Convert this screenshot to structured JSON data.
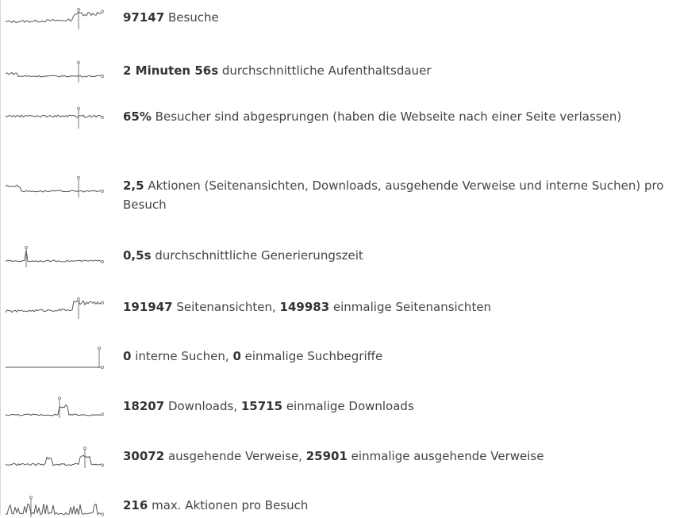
{
  "stats": [
    {
      "parts": [
        {
          "b": "97147"
        },
        {
          "t": " Besuche"
        }
      ]
    },
    {
      "parts": [
        {
          "b": "2 Minuten 56s"
        },
        {
          "t": " durchschnittliche Aufenthaltsdauer"
        }
      ]
    },
    {
      "parts": [
        {
          "b": "65%"
        },
        {
          "t": " Besucher sind abgesprungen (haben die Webseite nach einer Seite verlassen)"
        }
      ]
    },
    {
      "parts": [
        {
          "b": "2,5"
        },
        {
          "t": " Aktionen (Seitenansichten, Downloads, ausgehende Verweise und interne Suchen) pro Besuch"
        }
      ]
    },
    {
      "parts": [
        {
          "b": "0,5s"
        },
        {
          "t": " durchschnittliche Generierungszeit"
        }
      ]
    },
    {
      "parts": [
        {
          "b": "191947"
        },
        {
          "t": " Seitenansichten, "
        },
        {
          "b": "149983"
        },
        {
          "t": " einmalige Seitenansichten"
        }
      ]
    },
    {
      "parts": [
        {
          "b": "0"
        },
        {
          "t": " interne Suchen, "
        },
        {
          "b": "0"
        },
        {
          "t": " einmalige Suchbegriffe"
        }
      ]
    },
    {
      "parts": [
        {
          "b": "18207"
        },
        {
          "t": " Downloads, "
        },
        {
          "b": "15715"
        },
        {
          "t": " einmalige Downloads"
        }
      ]
    },
    {
      "parts": [
        {
          "b": "30072"
        },
        {
          "t": " ausgehende Verweise, "
        },
        {
          "b": "25901"
        },
        {
          "t": " einmalige ausgehende Verweise"
        }
      ]
    },
    {
      "parts": [
        {
          "b": "216"
        },
        {
          "t": " max. Aktionen pro Besuch"
        }
      ]
    }
  ]
}
